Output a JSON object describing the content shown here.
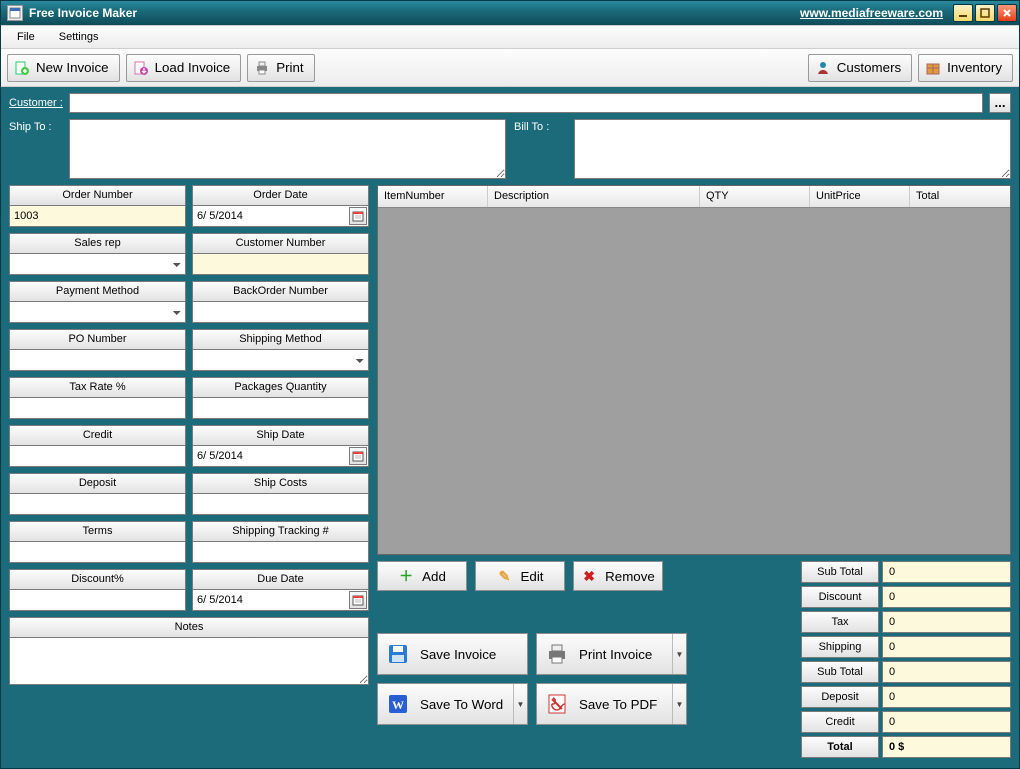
{
  "titlebar": {
    "title": "Free Invoice Maker",
    "link": "www.mediafreeware.com"
  },
  "menu": {
    "file": "File",
    "settings": "Settings"
  },
  "toolbar": {
    "new_invoice": "New Invoice",
    "load_invoice": "Load Invoice",
    "print": "Print",
    "customers": "Customers",
    "inventory": "Inventory"
  },
  "customer": {
    "label": "Customer :",
    "value": "",
    "dots": "..."
  },
  "ship_to": {
    "label": "Ship To :",
    "value": ""
  },
  "bill_to": {
    "label": "Bill To :",
    "value": ""
  },
  "form": {
    "order_number": {
      "label": "Order Number",
      "value": "1003"
    },
    "order_date": {
      "label": "Order Date",
      "value": "6/ 5/2014"
    },
    "sales_rep": {
      "label": "Sales rep",
      "value": ""
    },
    "customer_number": {
      "label": "Customer Number",
      "value": ""
    },
    "payment_method": {
      "label": "Payment Method",
      "value": ""
    },
    "backorder_number": {
      "label": "BackOrder Number",
      "value": ""
    },
    "po_number": {
      "label": "PO Number",
      "value": ""
    },
    "shipping_method": {
      "label": "Shipping Method",
      "value": ""
    },
    "tax_rate": {
      "label": "Tax Rate %",
      "value": ""
    },
    "packages_qty": {
      "label": "Packages Quantity",
      "value": ""
    },
    "credit": {
      "label": "Credit",
      "value": ""
    },
    "ship_date": {
      "label": "Ship Date",
      "value": "6/ 5/2014"
    },
    "deposit": {
      "label": "Deposit",
      "value": ""
    },
    "ship_costs": {
      "label": "Ship Costs",
      "value": ""
    },
    "terms": {
      "label": "Terms",
      "value": ""
    },
    "shipping_tracking": {
      "label": "Shipping Tracking #",
      "value": ""
    },
    "discount_pct": {
      "label": "Discount%",
      "value": ""
    },
    "due_date": {
      "label": "Due Date",
      "value": "6/ 5/2014"
    },
    "notes": {
      "label": "Notes",
      "value": ""
    }
  },
  "columns": {
    "item_number": "ItemNumber",
    "description": "Description",
    "qty": "QTY",
    "unit_price": "UnitPrice",
    "total": "Total"
  },
  "item_actions": {
    "add": "Add",
    "edit": "Edit",
    "remove": "Remove"
  },
  "save_actions": {
    "save_invoice": "Save Invoice",
    "print_invoice": "Print Invoice",
    "save_to_word": "Save To Word",
    "save_to_pdf": "Save To PDF"
  },
  "totals": {
    "sub_total": {
      "label": "Sub Total",
      "value": "0"
    },
    "discount": {
      "label": "Discount",
      "value": "0"
    },
    "tax": {
      "label": "Tax",
      "value": "0"
    },
    "shipping": {
      "label": "Shipping",
      "value": "0"
    },
    "sub_total2": {
      "label": "Sub Total",
      "value": "0"
    },
    "deposit": {
      "label": "Deposit",
      "value": "0"
    },
    "credit": {
      "label": "Credit",
      "value": "0"
    },
    "total": {
      "label": "Total",
      "value": "0 $"
    }
  }
}
